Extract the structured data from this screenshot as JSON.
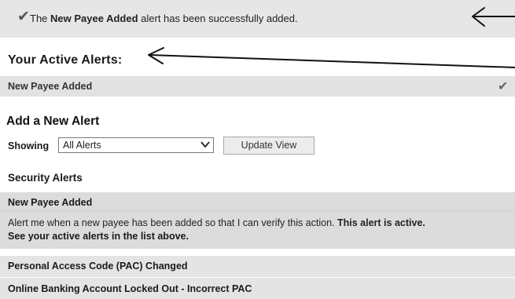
{
  "banner": {
    "icon": "checkmark-icon",
    "text_prefix": "The ",
    "alert_name": "New Payee Added",
    "text_suffix": " alert has been successfully added."
  },
  "active_alerts": {
    "title": "Your Active Alerts:",
    "items": [
      {
        "label": "New Payee Added",
        "icon": "checkmark-icon"
      }
    ]
  },
  "add_alert": {
    "title": "Add a New Alert",
    "showing_label": "Showing",
    "filter_selected": "All Alerts",
    "update_button": "Update View"
  },
  "security_alerts": {
    "title": "Security Alerts",
    "expanded_item": {
      "label": "New Payee Added",
      "description": "Alert me when a new payee has been added so that I can verify this action. ",
      "status": "This alert is active.",
      "active_link": "See your active alerts in the list above."
    },
    "items": [
      {
        "label": "Personal Access Code (PAC) Changed"
      },
      {
        "label": "Online Banking Account Locked Out - Incorrect PAC"
      }
    ]
  }
}
